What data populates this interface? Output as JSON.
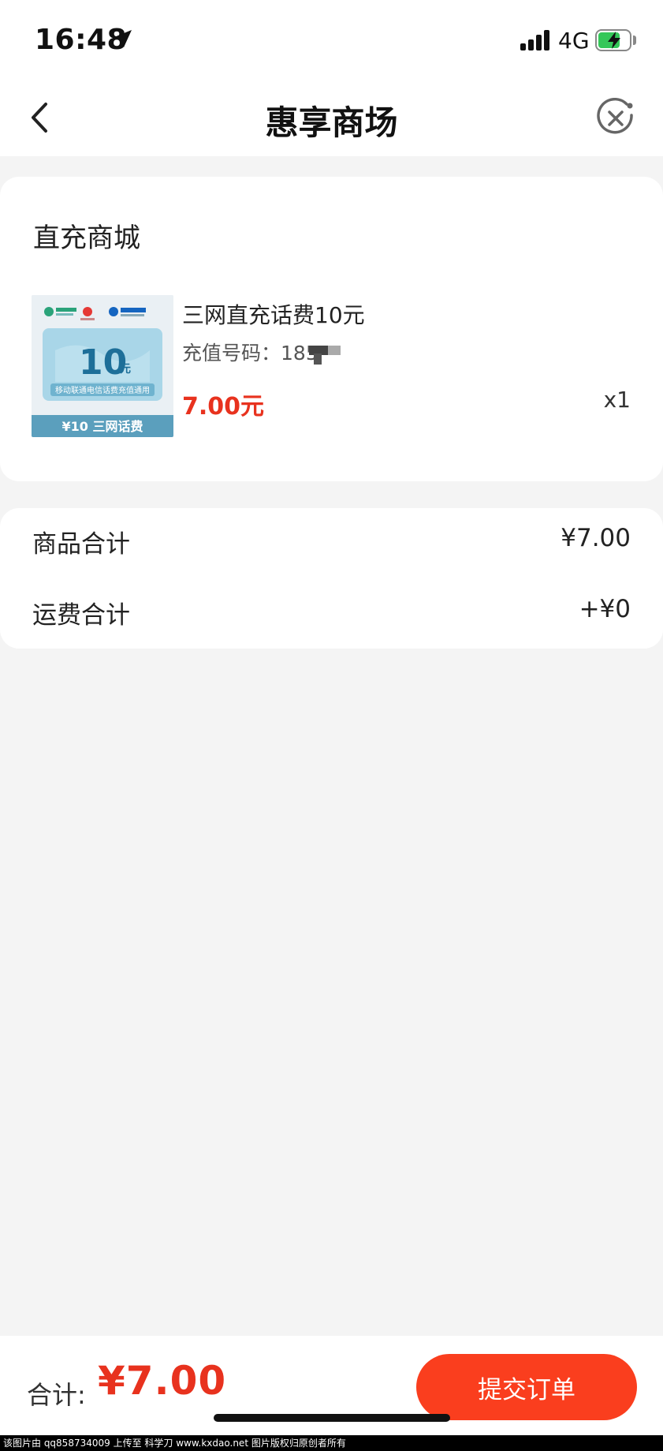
{
  "status_bar": {
    "time": "16:48",
    "network": "4G",
    "icons": [
      "location-arrow-icon",
      "signal-icon",
      "battery-charging-icon"
    ]
  },
  "nav": {
    "title": "惠享商场",
    "back_icon": "back-chevron-icon",
    "close_icon": "close-circle-icon"
  },
  "store": {
    "title": "直充商城",
    "product": {
      "name": "三网直充话费10元",
      "recharge_label": "充值号码：",
      "recharge_number": "185",
      "price": "7.00元",
      "quantity": "x1",
      "image": {
        "face_value": "10",
        "face_unit": "元",
        "caption": "移动联通电信话费充值通用",
        "banner": "¥10 三网话费"
      }
    }
  },
  "summary": {
    "goods_label": "商品合计",
    "goods_value": "¥7.00",
    "shipping_label": "运费合计",
    "shipping_value": "+¥0"
  },
  "bottom": {
    "total_label": "合计:",
    "total_value": "¥7.00",
    "submit_label": "提交订单"
  },
  "footer": {
    "text": "该图片由 qq858734009 上传至 科学刀 www.kxdao.net 图片版权归原创者所有"
  },
  "colors": {
    "accent": "#fa3e1e",
    "price": "#e8321e",
    "battery": "#35c759"
  }
}
